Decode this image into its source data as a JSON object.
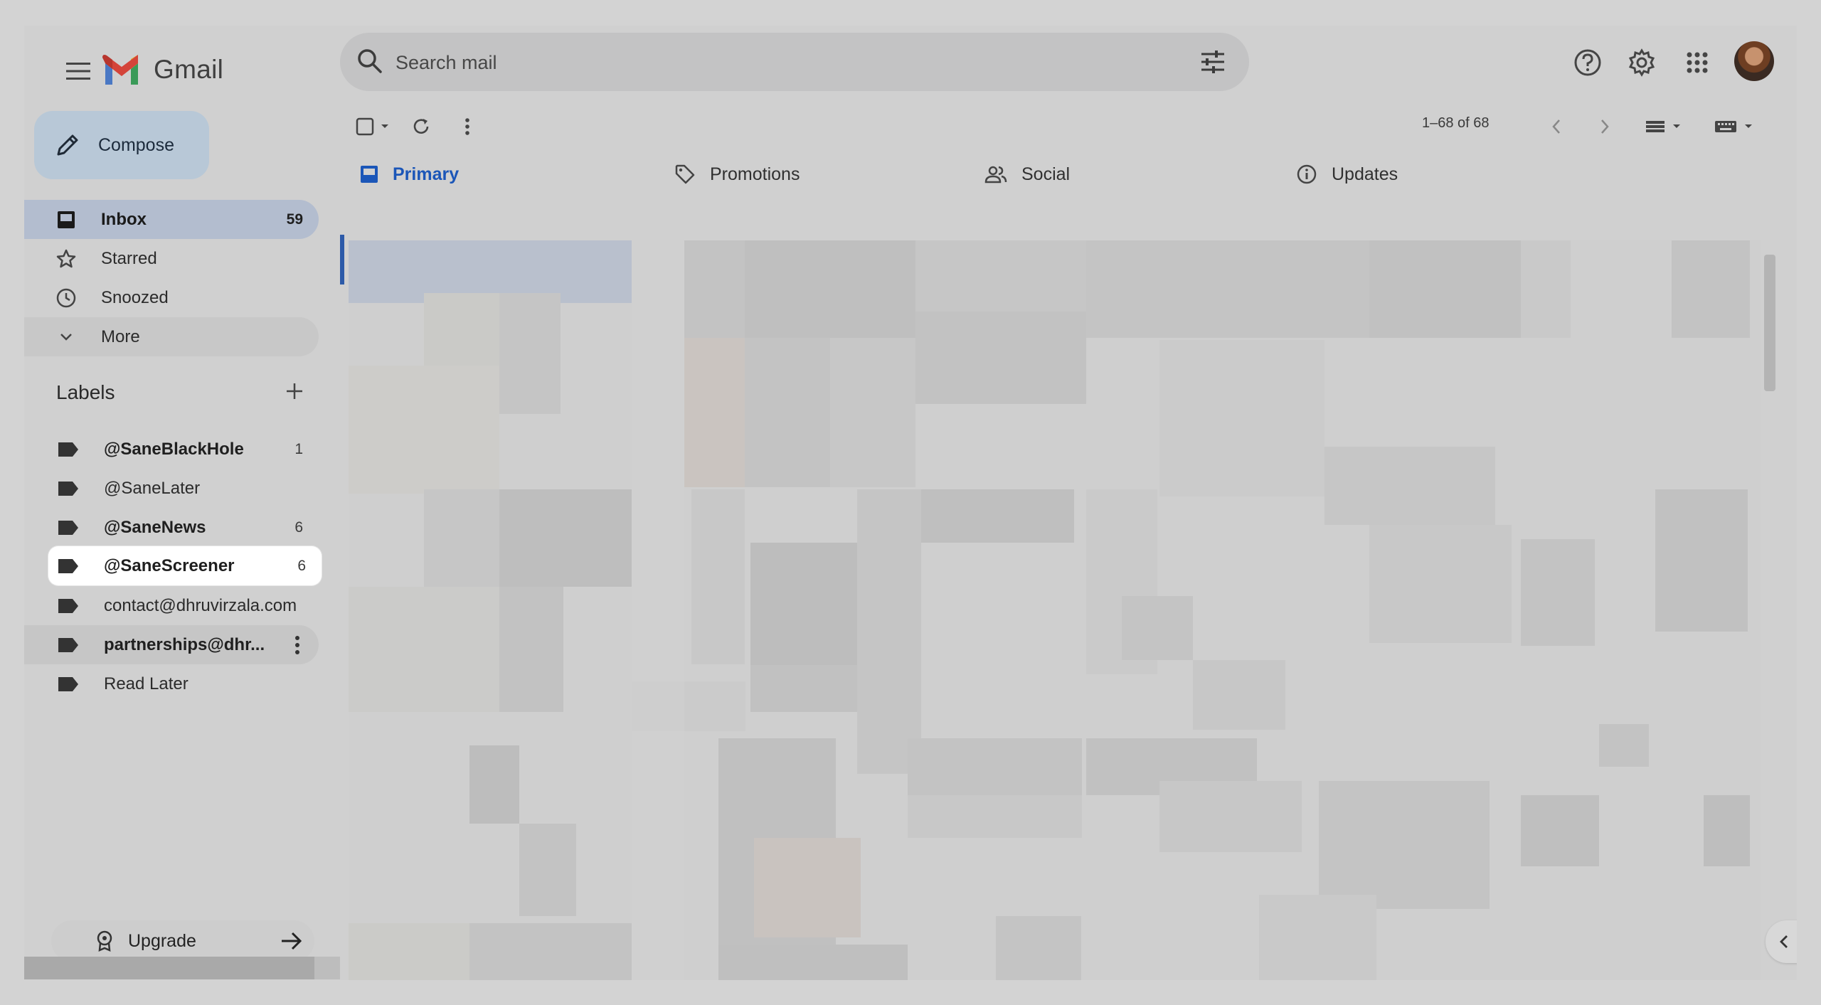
{
  "app": {
    "name": "Gmail"
  },
  "search": {
    "placeholder": "Search mail"
  },
  "compose": {
    "label": "Compose"
  },
  "nav": [
    {
      "label": "Inbox",
      "count": "59",
      "icon": "inbox-icon"
    },
    {
      "label": "Starred",
      "count": "",
      "icon": "star-icon"
    },
    {
      "label": "Snoozed",
      "count": "",
      "icon": "clock-icon"
    },
    {
      "label": "More",
      "count": "",
      "icon": "chevron-down-icon"
    }
  ],
  "labels": {
    "title": "Labels",
    "items": [
      {
        "label": "@SaneBlackHole",
        "count": "1"
      },
      {
        "label": "@SaneLater",
        "count": ""
      },
      {
        "label": "@SaneNews",
        "count": "6"
      },
      {
        "label": "@SaneScreener",
        "count": "6"
      },
      {
        "label": "contact@dhruvirzala.com",
        "count": ""
      },
      {
        "label": "partnerships@dhr...",
        "count": ""
      },
      {
        "label": "Read Later",
        "count": ""
      }
    ]
  },
  "upgrade": {
    "label": "Upgrade"
  },
  "toolbar": {
    "pager": "1–68 of 68"
  },
  "tabs": [
    {
      "label": "Primary",
      "icon": "inbox-icon"
    },
    {
      "label": "Promotions",
      "icon": "tag-icon"
    },
    {
      "label": "Social",
      "icon": "people-icon"
    },
    {
      "label": "Updates",
      "icon": "info-icon"
    }
  ],
  "colors": {
    "accent": "#1b56b8",
    "inbox_active_bg": "#b3bdcf",
    "compose_bg": "#b8c8d7"
  }
}
